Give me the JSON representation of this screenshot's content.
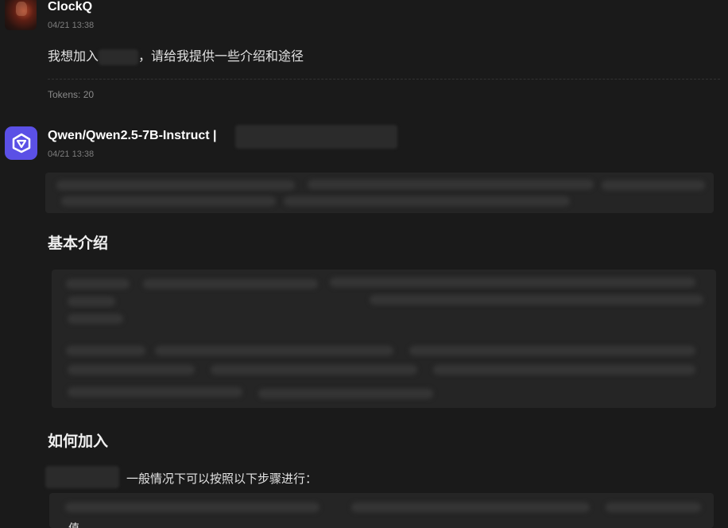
{
  "user_message": {
    "username": "ClockQ",
    "timestamp": "04/21 13:38",
    "text_before": "我想加入",
    "text_after": "，请给我提供一些介绍和途径",
    "tokens": "Tokens: 20"
  },
  "assistant_message": {
    "model_name": "Qwen/Qwen2.5-7B-Instruct |",
    "timestamp": "04/21 13:38",
    "sections": [
      {
        "heading": "基本介绍"
      },
      {
        "heading": "如何加入",
        "intro_text": "一般情况下可以按照以下步骤进行："
      }
    ],
    "trailing_char": "值"
  },
  "colors": {
    "background": "#1a1a1a",
    "bot_avatar": "#5b50e6",
    "redaction": "#2b2b2b"
  },
  "icons": {
    "user_avatar": "user-avatar-image",
    "bot_avatar": "qwen-logo-icon"
  }
}
